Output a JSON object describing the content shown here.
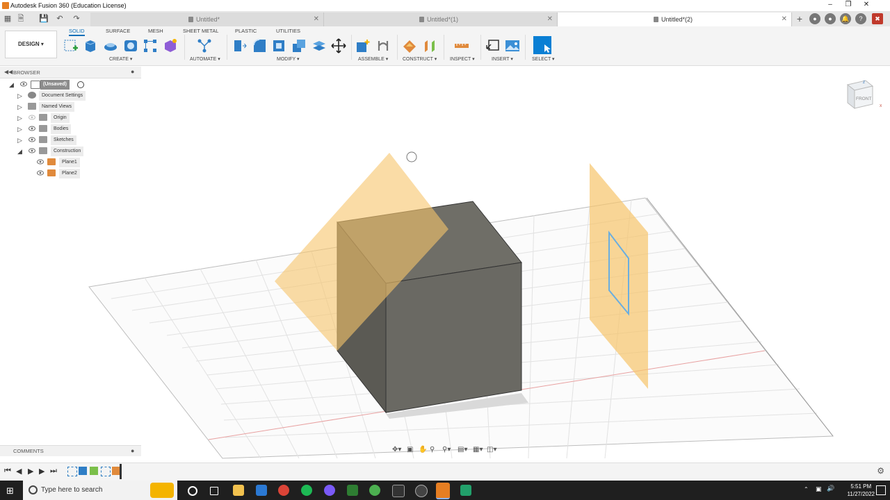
{
  "window": {
    "title": "Autodesk Fusion 360 (Education License)"
  },
  "tabs": [
    {
      "label": "Untitled*",
      "active": false
    },
    {
      "label": "Untitled*(1)",
      "active": false
    },
    {
      "label": "Untitled*(2)",
      "active": true
    }
  ],
  "toolbar": {
    "workspace": "DESIGN",
    "workspace_tabs": [
      "SOLID",
      "SURFACE",
      "MESH",
      "SHEET METAL",
      "PLASTIC",
      "UTILITIES"
    ],
    "active_tab": "SOLID",
    "groups": {
      "create": "CREATE",
      "automate": "AUTOMATE",
      "modify": "MODIFY",
      "assemble": "ASSEMBLE",
      "construct": "CONSTRUCT",
      "inspect": "INSPECT",
      "insert": "INSERT",
      "select": "SELECT"
    }
  },
  "browser": {
    "title": "BROWSER",
    "root": "(Unsaved)",
    "items": [
      {
        "label": "Document Settings",
        "icon": "gear-icon"
      },
      {
        "label": "Named Views",
        "icon": "folder-icon"
      },
      {
        "label": "Origin",
        "icon": "folder-icon"
      },
      {
        "label": "Bodies",
        "icon": "folder-icon"
      },
      {
        "label": "Sketches",
        "icon": "folder-icon"
      },
      {
        "label": "Construction",
        "icon": "folder-icon",
        "expanded": true
      }
    ],
    "construction_children": [
      {
        "label": "Plane1"
      },
      {
        "label": "Plane2"
      }
    ]
  },
  "viewcube": {
    "face": "FRONT"
  },
  "comments": {
    "title": "COMMENTS"
  },
  "taskbar": {
    "search_placeholder": "Type here to search",
    "time": "5:51 PM",
    "date": "11/27/2022"
  },
  "colors": {
    "accent": "#0a6fb8",
    "plane": "#f6c56b",
    "body": "#6b6a64"
  }
}
